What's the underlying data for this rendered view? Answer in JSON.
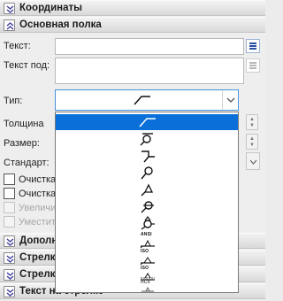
{
  "sections": {
    "coords": "Координаты",
    "main": "Основная полка",
    "extra": "Дополн",
    "arrow1": "Стрелк",
    "arrow2": "Стрелк",
    "on_arrow": "Текст на стрелке"
  },
  "fields": {
    "text_label": "Текст:",
    "text_under_label": "Текст под:",
    "type_label": "Тип:",
    "thickness_label": "Толщина",
    "size_label": "Размер:",
    "standard_label": "Стандарт:"
  },
  "checkboxes": [
    {
      "label": "Очистка",
      "checked": false,
      "enabled": true
    },
    {
      "label": "Очистка",
      "checked": false,
      "enabled": true
    },
    {
      "label": "Увеличи",
      "checked": false,
      "enabled": false
    },
    {
      "label": "Уместит",
      "checked": false,
      "enabled": false
    }
  ],
  "type_dropdown": {
    "selected_index": 0,
    "options": [
      {
        "icon": "leader-line-icon",
        "tag": ""
      },
      {
        "icon": "circle-target-icon",
        "tag": ""
      },
      {
        "icon": "step-line-icon",
        "tag": ""
      },
      {
        "icon": "circle-leader-icon",
        "tag": ""
      },
      {
        "icon": "triangle-leader-icon",
        "tag": ""
      },
      {
        "icon": "circle-dash-icon",
        "tag": ""
      },
      {
        "icon": "circle-triangle-icon",
        "tag": ""
      },
      {
        "icon": "ansi-weld-icon",
        "tag": "ANSI"
      },
      {
        "icon": "iso-weld-icon",
        "tag": "ISO"
      },
      {
        "icon": "iso-weld-alt-icon",
        "tag": "ISO"
      },
      {
        "icon": "hc9-weld-icon",
        "tag": "HC9"
      }
    ]
  },
  "colors": {
    "selection": "#0a6fd8",
    "accent_border": "#4a90d9"
  }
}
